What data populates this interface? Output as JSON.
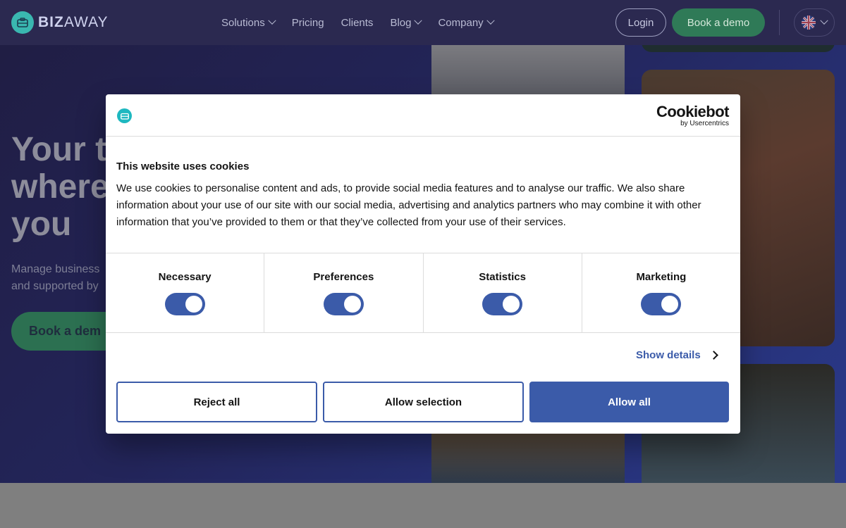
{
  "nav": {
    "brand": {
      "bold": "BIZ",
      "light": "AWAY"
    },
    "links": [
      {
        "label": "Solutions",
        "has_dropdown": true
      },
      {
        "label": "Pricing",
        "has_dropdown": false
      },
      {
        "label": "Clients",
        "has_dropdown": false
      },
      {
        "label": "Blog",
        "has_dropdown": true
      },
      {
        "label": "Company",
        "has_dropdown": true
      }
    ],
    "login_label": "Login",
    "demo_label": "Book a demo",
    "language_icon": "uk-flag-icon"
  },
  "hero": {
    "title_lines": [
      "Your t",
      "where",
      "you"
    ],
    "subtitle_lines": [
      "Manage business",
      "and supported by"
    ],
    "cta_label": "Book a dem"
  },
  "cookie_dialog": {
    "brand_name": "Cookiebot",
    "brand_by": "by Usercentrics",
    "title": "This website uses cookies",
    "text": "We use cookies to personalise content and ads, to provide social media features and to analyse our traffic. We also share information about your use of our site with our social media, advertising and analytics partners who may combine it with other information that you’ve provided to them or that they’ve collected from your use of their services.",
    "toggles": [
      {
        "label": "Necessary",
        "checked": true
      },
      {
        "label": "Preferences",
        "checked": true
      },
      {
        "label": "Statistics",
        "checked": true
      },
      {
        "label": "Marketing",
        "checked": true
      }
    ],
    "show_details_label": "Show details",
    "reject_label": "Reject all",
    "allow_selection_label": "Allow selection",
    "allow_all_label": "Allow all"
  },
  "colors": {
    "accent_blue": "#3b5ba9",
    "brand_teal": "#1eb8c0",
    "cta_green": "#2f7a57"
  }
}
